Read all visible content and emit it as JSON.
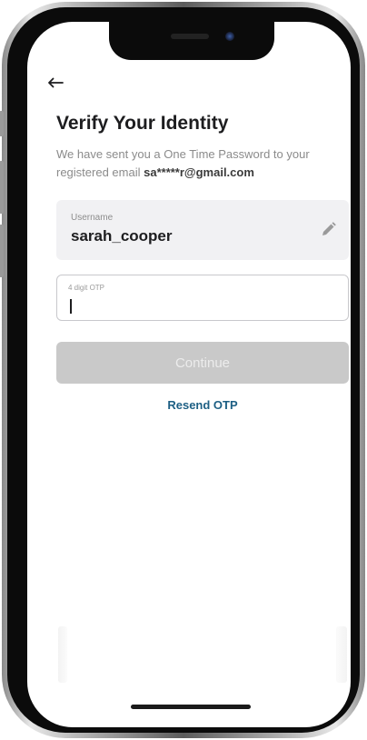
{
  "header": {
    "back_icon": "arrow-left-icon",
    "title": "Verify Your Identity"
  },
  "subtitle": {
    "text": "We have sent you a One Time Password to your registered email ",
    "email": "sa*****r@gmail.com"
  },
  "username_field": {
    "label": "Username",
    "value": "sarah_cooper",
    "edit_icon": "pencil-icon"
  },
  "otp_field": {
    "label": "4 digit OTP",
    "value": ""
  },
  "actions": {
    "continue_label": "Continue",
    "resend_label": "Resend OTP"
  },
  "colors": {
    "link": "#1d5f84",
    "disabled_button": "#c9c9c9",
    "field_background": "#f1f1f3"
  }
}
